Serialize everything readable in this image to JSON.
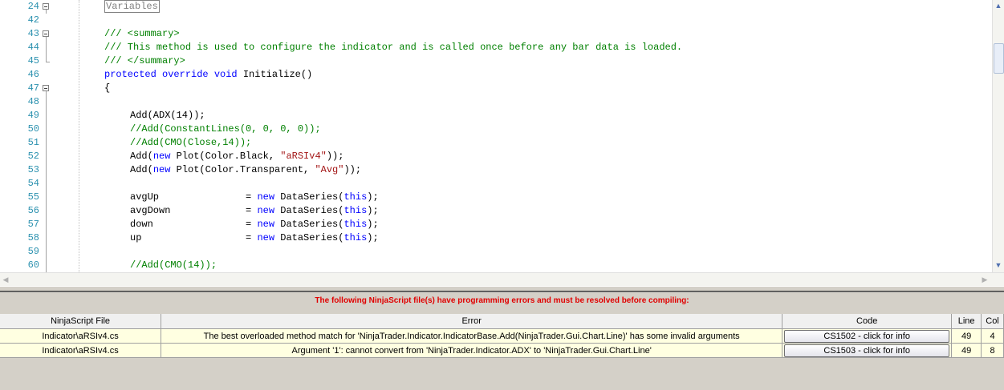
{
  "editor": {
    "lines": [
      {
        "num": "24",
        "indent": 0,
        "fold": "box",
        "parts": [
          {
            "t": "Variables",
            "c": "region"
          }
        ]
      },
      {
        "num": "42",
        "indent": 0,
        "fold": "",
        "parts": []
      },
      {
        "num": "43",
        "indent": 0,
        "fold": "box",
        "parts": [
          {
            "t": "/// <summary>",
            "c": "cm-tag"
          }
        ]
      },
      {
        "num": "44",
        "indent": 0,
        "fold": "line",
        "parts": [
          {
            "t": "/// This method is used to configure the indicator and is called once before any bar data is loaded.",
            "c": "cm"
          }
        ]
      },
      {
        "num": "45",
        "indent": 0,
        "fold": "end",
        "parts": [
          {
            "t": "/// </summary>",
            "c": "cm-tag"
          }
        ]
      },
      {
        "num": "46",
        "indent": 0,
        "fold": "",
        "parts": [
          {
            "t": "protected override void",
            "c": "kw"
          },
          {
            "t": " Initialize()",
            "c": ""
          }
        ]
      },
      {
        "num": "47",
        "indent": 0,
        "fold": "box",
        "parts": [
          {
            "t": "{",
            "c": ""
          }
        ]
      },
      {
        "num": "48",
        "indent": 0,
        "fold": "line",
        "parts": []
      },
      {
        "num": "49",
        "indent": 1,
        "fold": "line",
        "parts": [
          {
            "t": "Add(ADX(14));",
            "c": ""
          }
        ]
      },
      {
        "num": "50",
        "indent": 1,
        "fold": "line",
        "parts": [
          {
            "t": "//Add(ConstantLines(0, 0, 0, 0));",
            "c": "cm"
          }
        ]
      },
      {
        "num": "51",
        "indent": 1,
        "fold": "line",
        "parts": [
          {
            "t": "//Add(CMO(Close,14));",
            "c": "cm"
          }
        ]
      },
      {
        "num": "52",
        "indent": 1,
        "fold": "line",
        "parts": [
          {
            "t": "Add(",
            "c": ""
          },
          {
            "t": "new",
            "c": "kw"
          },
          {
            "t": " Plot(Color.Black, ",
            "c": ""
          },
          {
            "t": "\"aRSIv4\"",
            "c": "str"
          },
          {
            "t": "));",
            "c": ""
          }
        ]
      },
      {
        "num": "53",
        "indent": 1,
        "fold": "line",
        "parts": [
          {
            "t": "Add(",
            "c": ""
          },
          {
            "t": "new",
            "c": "kw"
          },
          {
            "t": " Plot(Color.Transparent, ",
            "c": ""
          },
          {
            "t": "\"Avg\"",
            "c": "str"
          },
          {
            "t": "));",
            "c": ""
          }
        ]
      },
      {
        "num": "54",
        "indent": 1,
        "fold": "line",
        "parts": []
      },
      {
        "num": "55",
        "indent": 1,
        "fold": "line",
        "parts": [
          {
            "t": "avgUp               = ",
            "c": ""
          },
          {
            "t": "new",
            "c": "kw"
          },
          {
            "t": " DataSeries(",
            "c": ""
          },
          {
            "t": "this",
            "c": "kw"
          },
          {
            "t": ");",
            "c": ""
          }
        ]
      },
      {
        "num": "56",
        "indent": 1,
        "fold": "line",
        "parts": [
          {
            "t": "avgDown             = ",
            "c": ""
          },
          {
            "t": "new",
            "c": "kw"
          },
          {
            "t": " DataSeries(",
            "c": ""
          },
          {
            "t": "this",
            "c": "kw"
          },
          {
            "t": ");",
            "c": ""
          }
        ]
      },
      {
        "num": "57",
        "indent": 1,
        "fold": "line",
        "parts": [
          {
            "t": "down                = ",
            "c": ""
          },
          {
            "t": "new",
            "c": "kw"
          },
          {
            "t": " DataSeries(",
            "c": ""
          },
          {
            "t": "this",
            "c": "kw"
          },
          {
            "t": ");",
            "c": ""
          }
        ]
      },
      {
        "num": "58",
        "indent": 1,
        "fold": "line",
        "parts": [
          {
            "t": "up                  = ",
            "c": ""
          },
          {
            "t": "new",
            "c": "kw"
          },
          {
            "t": " DataSeries(",
            "c": ""
          },
          {
            "t": "this",
            "c": "kw"
          },
          {
            "t": ");",
            "c": ""
          }
        ]
      },
      {
        "num": "59",
        "indent": 1,
        "fold": "line",
        "parts": []
      },
      {
        "num": "60",
        "indent": 1,
        "fold": "line",
        "parts": [
          {
            "t": "//Add(CMO(14));",
            "c": "cm"
          }
        ]
      }
    ]
  },
  "errors": {
    "title": "The following NinjaScript file(s) have programming errors and must be resolved before compiling:",
    "columns": {
      "file": "NinjaScript File",
      "error": "Error",
      "code": "Code",
      "line": "Line",
      "col": "Col"
    },
    "rows": [
      {
        "file": "Indicator\\aRSIv4.cs",
        "error": "The best overloaded method match for 'NinjaTrader.Indicator.IndicatorBase.Add(NinjaTrader.Gui.Chart.Line)' has some invalid arguments",
        "code": "CS1502 - click for info",
        "line": "49",
        "col": "4"
      },
      {
        "file": "Indicator\\aRSIv4.cs",
        "error": "Argument '1': cannot convert from 'NinjaTrader.Indicator.ADX' to 'NinjaTrader.Gui.Chart.Line'",
        "code": "CS1503 - click for info",
        "line": "49",
        "col": "8"
      }
    ]
  },
  "icons": {
    "scroll_up": "chevron-up-icon",
    "scroll_down": "chevron-down-icon",
    "scroll_left": "chevron-left-icon",
    "scroll_right": "chevron-right-icon"
  },
  "colors": {
    "keyword": "#0000ff",
    "comment": "#008000",
    "string": "#a31515",
    "line_number": "#2b91af",
    "error_title": "#e00000",
    "error_row": "#ffffe1"
  }
}
